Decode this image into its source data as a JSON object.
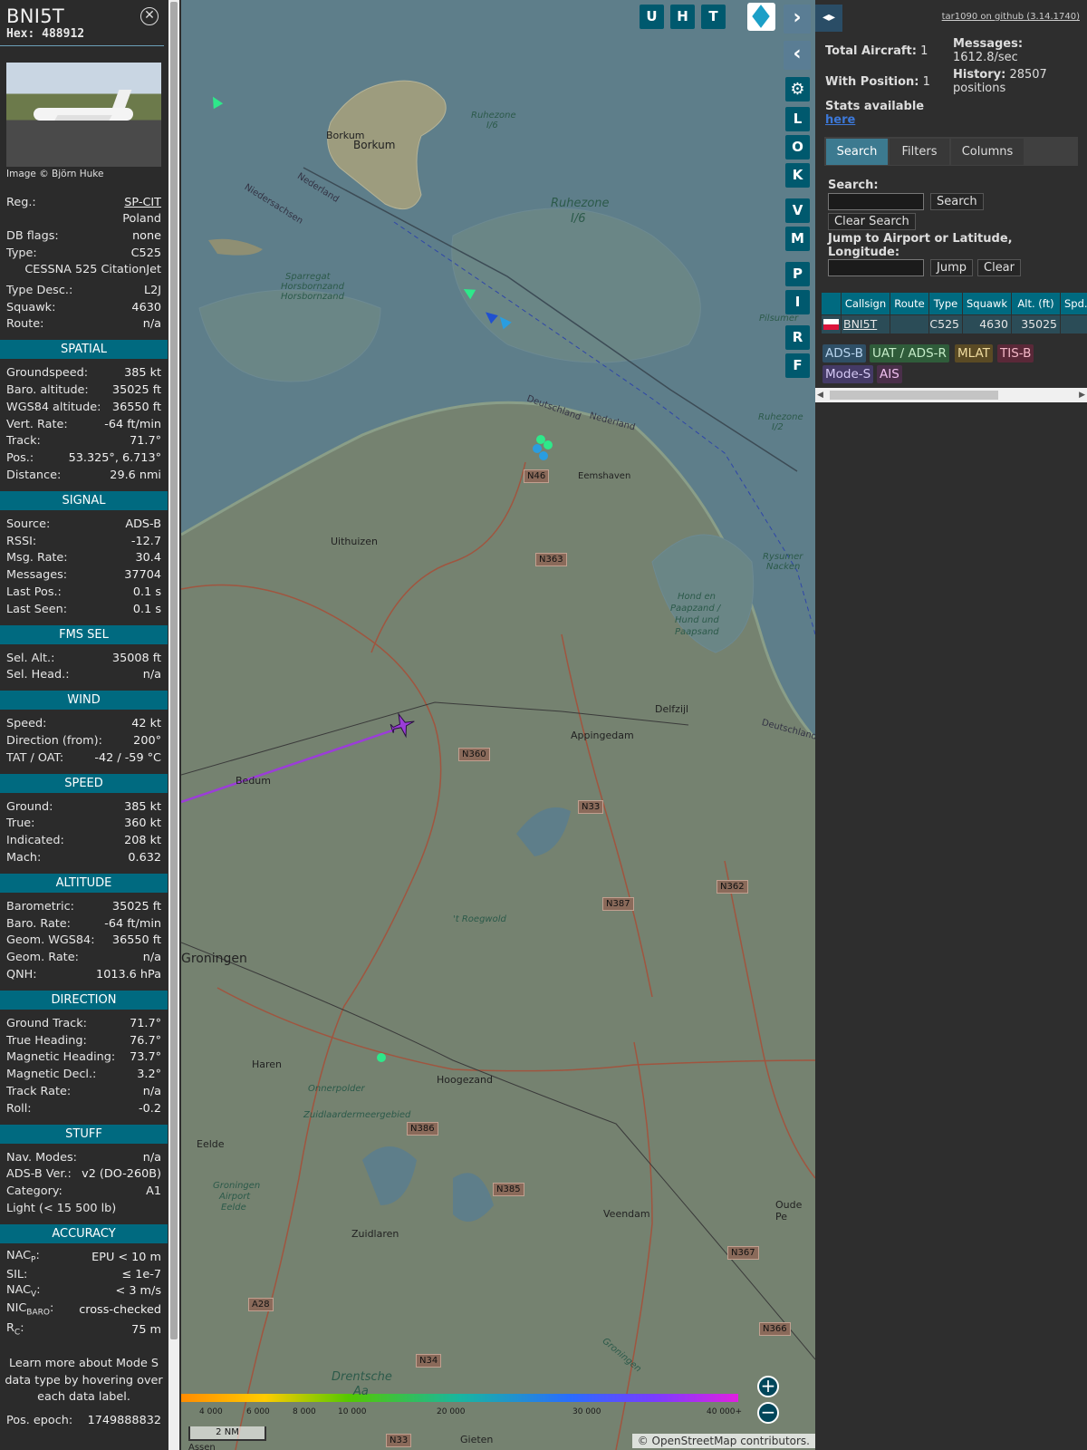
{
  "sidebar": {
    "callsign": "BNI5T",
    "hex_label": "Hex:",
    "hex_value": "488912",
    "photo_credit": "Image © Björn Huke",
    "basic": {
      "reg_label": "Reg.:",
      "reg_value": "SP-CIT",
      "country": "Poland",
      "dbflags_label": "DB flags:",
      "dbflags_value": "none",
      "type_label": "Type:",
      "type_value": "C525",
      "type_full": "CESSNA 525 CitationJet",
      "typedesc_label": "Type Desc.:",
      "typedesc_value": "L2J",
      "squawk_label": "Squawk:",
      "squawk_value": "4630",
      "route_label": "Route:",
      "route_value": "n/a"
    },
    "spatial": {
      "title": "SPATIAL",
      "rows": [
        {
          "k": "Groundspeed:",
          "v": "385 kt"
        },
        {
          "k": "Baro. altitude:",
          "v": "35025 ft"
        },
        {
          "k": "WGS84 altitude:",
          "v": "36550 ft"
        },
        {
          "k": "Vert. Rate:",
          "v": "-64 ft/min"
        },
        {
          "k": "Track:",
          "v": "71.7°"
        },
        {
          "k": "Pos.:",
          "v": "53.325°, 6.713°"
        },
        {
          "k": "Distance:",
          "v": "29.6 nmi"
        }
      ]
    },
    "signal": {
      "title": "SIGNAL",
      "rows": [
        {
          "k": "Source:",
          "v": "ADS-B"
        },
        {
          "k": "RSSI:",
          "v": "-12.7"
        },
        {
          "k": "Msg. Rate:",
          "v": "30.4"
        },
        {
          "k": "Messages:",
          "v": "37704"
        },
        {
          "k": "Last Pos.:",
          "v": "0.1 s"
        },
        {
          "k": "Last Seen:",
          "v": "0.1 s"
        }
      ]
    },
    "fms": {
      "title": "FMS SEL",
      "rows": [
        {
          "k": "Sel. Alt.:",
          "v": "35008 ft"
        },
        {
          "k": "Sel. Head.:",
          "v": "n/a"
        }
      ]
    },
    "wind": {
      "title": "WIND",
      "rows": [
        {
          "k": "Speed:",
          "v": "42 kt"
        },
        {
          "k": "Direction (from):",
          "v": "200°"
        },
        {
          "k": "TAT / OAT:",
          "v": "-42 / -59 °C"
        }
      ]
    },
    "speed": {
      "title": "SPEED",
      "rows": [
        {
          "k": "Ground:",
          "v": "385 kt"
        },
        {
          "k": "True:",
          "v": "360 kt"
        },
        {
          "k": "Indicated:",
          "v": "208 kt"
        },
        {
          "k": "Mach:",
          "v": "0.632"
        }
      ]
    },
    "altitude": {
      "title": "ALTITUDE",
      "rows": [
        {
          "k": "Barometric:",
          "v": "35025 ft"
        },
        {
          "k": "Baro. Rate:",
          "v": "-64 ft/min"
        },
        {
          "k": "Geom. WGS84:",
          "v": "36550 ft"
        },
        {
          "k": "Geom. Rate:",
          "v": "n/a"
        },
        {
          "k": "QNH:",
          "v": "1013.6 hPa"
        }
      ]
    },
    "direction": {
      "title": "DIRECTION",
      "rows": [
        {
          "k": "Ground Track:",
          "v": "71.7°"
        },
        {
          "k": "True Heading:",
          "v": "76.7°"
        },
        {
          "k": "Magnetic Heading:",
          "v": "73.7°"
        },
        {
          "k": "Magnetic Decl.:",
          "v": "3.2°"
        },
        {
          "k": "Track Rate:",
          "v": "n/a"
        },
        {
          "k": "Roll:",
          "v": "-0.2"
        }
      ]
    },
    "stuff": {
      "title": "STUFF",
      "rows": [
        {
          "k": "Nav. Modes:",
          "v": "n/a"
        },
        {
          "k": "ADS-B Ver.:",
          "v": "v2 (DO-260B)"
        },
        {
          "k": "Category:",
          "v": "A1"
        }
      ],
      "category_desc": "Light (< 15 500 lb)"
    },
    "accuracy": {
      "title": "ACCURACY",
      "nacp_label": "NAC",
      "nacp_sub": "P",
      "nacp_value": "EPU < 10 m",
      "sil_label": "SIL:",
      "sil_value": "≤ 1e-7",
      "nacv_label": "NAC",
      "nacv_sub": "V",
      "nacv_value": "< 3 m/s",
      "nicbaro_label": "NIC",
      "nicbaro_sub": "BARO",
      "nicbaro_value": "cross-checked",
      "rc_label": "R",
      "rc_sub": "C",
      "rc_value": "75 m"
    },
    "learn_more": "Learn more about Mode S data type by hovering over each data label.",
    "epoch_label": "Pos. epoch:",
    "epoch_value": "1749888832"
  },
  "map": {
    "buttons": [
      "U",
      "H",
      "T"
    ],
    "side_buttons": [
      "L",
      "O",
      "K",
      "V",
      "M",
      "P",
      "I",
      "R",
      "F"
    ],
    "labels": {
      "borkum": "Borkum",
      "borkum2": "Borkum",
      "ruhezone": "Ruhezone",
      "ruhezone_sub": "I/6",
      "ruhezone_small": "Ruhezone",
      "ruhezone_small_sub": "I/6",
      "niedersachsen": "Niedersachsen",
      "nederland": "Nederland",
      "deutschland": "Deutschland",
      "nederland2": "Nederland",
      "sparregat": "Sparregat",
      "horsbornzand": "Horsbornzand",
      "horsbornzand2": "Horsbornzand",
      "pilsumer": "Pilsumer",
      "eemshaven": "Eemshaven",
      "uithuizen": "Uithuizen",
      "hondpaap": "Hond en",
      "hondpaap2": "Paapzand /",
      "hondpaap3": "Hund und",
      "hondpaap4": "Paapsand",
      "rysumer": "Rysumer",
      "nacken": "Nacken",
      "delfzijl": "Delfzijl",
      "appingedam": "Appingedam",
      "bedum": "Bedum",
      "groningen": "Groningen",
      "roegwold": "'t Roegwold",
      "haren": "Haren",
      "hoogezand": "Hoogezand",
      "onnerpolder": "Onnerpolder",
      "zuidlaardermeer": "Zuidlaardermeergebied",
      "eelde": "Eelde",
      "gae": "Groningen",
      "gae2": "Airport",
      "gae3": "Eelde",
      "zuidlaren": "Zuidlaren",
      "veendam": "Veendam",
      "oudepe": "Oude Pe",
      "drentsche": "Drentsche",
      "aa": "Aa",
      "gieten": "Gieten",
      "assen": "Assen",
      "deutschland2": "Deutschland",
      "ruhezone3": "Ruhezone",
      "ruhezone3b": "I/2",
      "groningen_rail": "Groningen"
    },
    "roads": [
      "N46",
      "N363",
      "N360",
      "N33",
      "N387",
      "N362",
      "N386",
      "N385",
      "N367",
      "N366",
      "A28",
      "N34",
      "N33"
    ],
    "altitude_scale": [
      "4 000",
      "6 000",
      "8 000",
      "10 000",
      "20 000",
      "30 000",
      "40 000+"
    ],
    "scale_bar": "2 NM",
    "attribution": "© OpenStreetMap contributors."
  },
  "right_panel": {
    "github_link": "tar1090 on github (3.14.1740)",
    "total_aircraft_label": "Total Aircraft:",
    "total_aircraft_value": "1",
    "with_position_label": "With Position:",
    "with_position_value": "1",
    "stats_label": "Stats available",
    "stats_link": "here",
    "messages_label": "Messages:",
    "messages_value": "1612.8/sec",
    "history_label": "History:",
    "history_value": "28507",
    "history_unit": "positions",
    "tabs": [
      "Search",
      "Filters",
      "Columns"
    ],
    "search_label": "Search:",
    "search_button": "Search",
    "clear_search_button": "Clear Search",
    "jump_label": "Jump to Airport or Latitude, Longitude:",
    "jump_button": "Jump",
    "clear_button": "Clear",
    "table": {
      "headers": [
        "Callsign",
        "Route",
        "Type",
        "Squawk",
        "Alt. (ft)",
        "Spd."
      ],
      "row": {
        "callsign": "BNI5T",
        "route": "",
        "type": "C525",
        "squawk": "4630",
        "alt": "35025"
      }
    },
    "legend": [
      {
        "label": "ADS-B",
        "bg": "#2f4f66",
        "fg": "#b8d4ee"
      },
      {
        "label": "UAT / ADS-R",
        "bg": "#2f5c3a",
        "fg": "#c5ecc8"
      },
      {
        "label": "MLAT",
        "bg": "#5a4a24",
        "fg": "#f0dca0"
      },
      {
        "label": "TIS-B",
        "bg": "#5a2838",
        "fg": "#f5b8c8"
      },
      {
        "label": "Mode-S",
        "bg": "#443a66",
        "fg": "#d4c8f4"
      },
      {
        "label": "AIS",
        "bg": "#4a2f4a",
        "fg": "#f0c0f0"
      }
    ]
  }
}
